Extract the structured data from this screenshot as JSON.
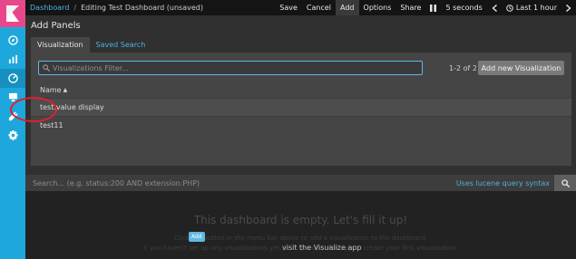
{
  "topbar": {
    "breadcrumbs": [
      "Dashboard",
      "Editing Test Dashboard (unsaved)"
    ],
    "actions": {
      "save": "Save",
      "cancel": "Cancel",
      "add": "Add",
      "options": "Options",
      "share": "Share",
      "interval": "5 seconds",
      "time": "Last 1 hour"
    }
  },
  "panel": {
    "title": "Add Panels",
    "tabs": [
      "Visualization",
      "Saved Search"
    ],
    "filter_placeholder": "Visualizations Filter...",
    "count": "1-2 of 2",
    "add_new_label": "Add new Visualization",
    "column_header": "Name",
    "items": [
      "test.value display",
      "test11"
    ]
  },
  "search": {
    "placeholder": "Search... (e.g. status:200 AND extension:PHP)",
    "lucene_link": "Uses lucene query syntax"
  },
  "empty": {
    "title": "This dashboard is empty. Let's fill it up!",
    "line1": "Click the button in the menu bar above to add a visualization to the dashboard.",
    "add_chip": "Add",
    "line2": "If you haven't set up any visualizations yet, visit the Visualize app to create your first visualization.",
    "visit_link": "visit the Visualize app"
  },
  "colors": {
    "nav": "#1ea7dd",
    "logo": "#e8488b",
    "accent": "#4fb1e0",
    "annotation": "#e3202a"
  }
}
